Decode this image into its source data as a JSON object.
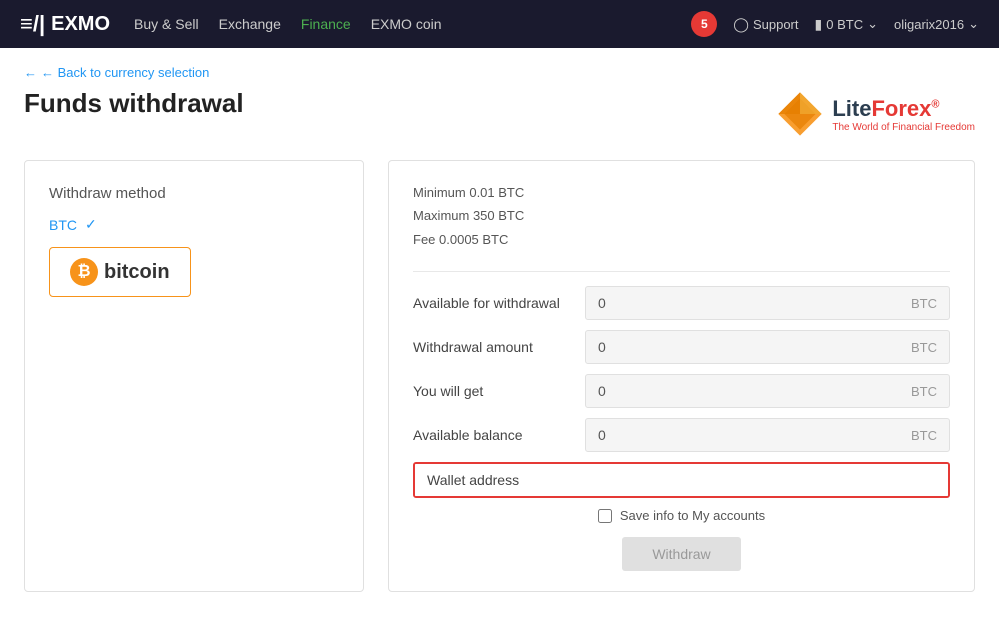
{
  "header": {
    "logo_text": "EXMO",
    "logo_icon": "≡/|",
    "nav": [
      {
        "label": "Buy & Sell",
        "active": false
      },
      {
        "label": "Exchange",
        "active": false
      },
      {
        "label": "Finance",
        "active": true
      },
      {
        "label": "EXMO coin",
        "active": false
      }
    ],
    "notification_count": "5",
    "support_label": "Support",
    "wallet_label": "0 BTC",
    "user_label": "oligarix2016"
  },
  "breadcrumb": "← Back to currency selection",
  "page_title": "Funds withdrawal",
  "liteforex": {
    "name": "LiteForex",
    "registered": "®",
    "tagline": "The World of Financial Freedom"
  },
  "left_panel": {
    "section_label": "Withdraw method",
    "method_name": "BTC",
    "bitcoin_label": "bitcoin"
  },
  "right_panel": {
    "info": {
      "minimum": "Minimum 0.01 BTC",
      "maximum": "Maximum 350 BTC",
      "fee": "Fee 0.0005 BTC"
    },
    "fields": [
      {
        "label": "Available for withdrawal",
        "value": "0",
        "unit": "BTC"
      },
      {
        "label": "Withdrawal amount",
        "value": "0",
        "unit": "BTC"
      },
      {
        "label": "You will get",
        "value": "0",
        "unit": "BTC"
      },
      {
        "label": "Available balance",
        "value": "0",
        "unit": "BTC"
      }
    ],
    "wallet_label": "Wallet address",
    "wallet_placeholder": "",
    "save_label": "Save info to My accounts",
    "withdraw_button": "Withdraw"
  }
}
